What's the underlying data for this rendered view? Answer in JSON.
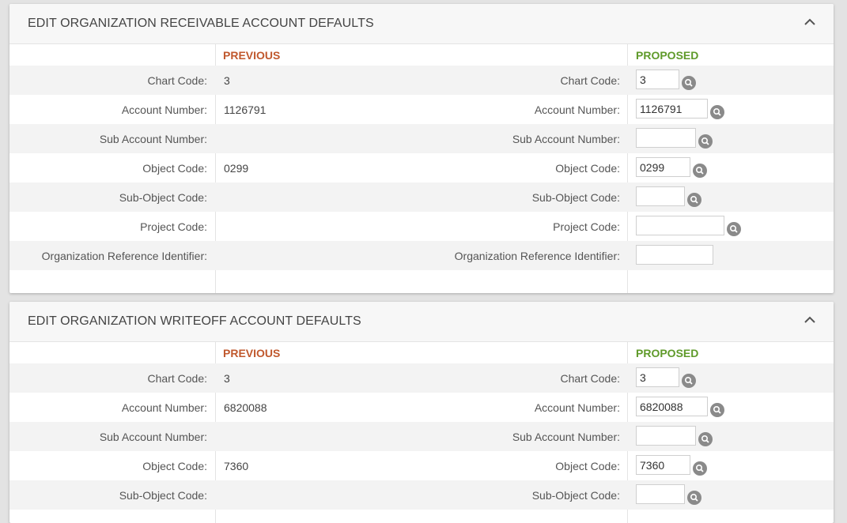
{
  "receivable": {
    "title": "EDIT ORGANIZATION RECEIVABLE ACCOUNT DEFAULTS",
    "previous_label": "PREVIOUS",
    "proposed_label": "PROPOSED",
    "rows": [
      {
        "label": "Chart Code:",
        "previous": "3",
        "proposed": "3"
      },
      {
        "label": "Account Number:",
        "previous": "1126791",
        "proposed": "1126791"
      },
      {
        "label": "Sub Account Number:",
        "previous": "",
        "proposed": ""
      },
      {
        "label": "Object Code:",
        "previous": "0299",
        "proposed": "0299"
      },
      {
        "label": "Sub-Object Code:",
        "previous": "",
        "proposed": ""
      },
      {
        "label": "Project Code:",
        "previous": "",
        "proposed": ""
      },
      {
        "label": "Organization Reference Identifier:",
        "previous": "",
        "proposed": ""
      }
    ]
  },
  "writeoff": {
    "title": "EDIT ORGANIZATION WRITEOFF ACCOUNT DEFAULTS",
    "previous_label": "PREVIOUS",
    "proposed_label": "PROPOSED",
    "rows": [
      {
        "label": "Chart Code:",
        "previous": "3",
        "proposed": "3"
      },
      {
        "label": "Account Number:",
        "previous": "6820088",
        "proposed": "6820088"
      },
      {
        "label": "Sub Account Number:",
        "previous": "",
        "proposed": ""
      },
      {
        "label": "Object Code:",
        "previous": "7360",
        "proposed": "7360"
      },
      {
        "label": "Sub-Object Code:",
        "previous": "",
        "proposed": ""
      }
    ]
  },
  "colors": {
    "previous": "#c0582d",
    "proposed": "#5f9a2a",
    "lookup_icon": "#8a8a8a"
  },
  "icons": {
    "collapse": "chevron-up-icon",
    "lookup": "magnifier-lookup-icon"
  }
}
